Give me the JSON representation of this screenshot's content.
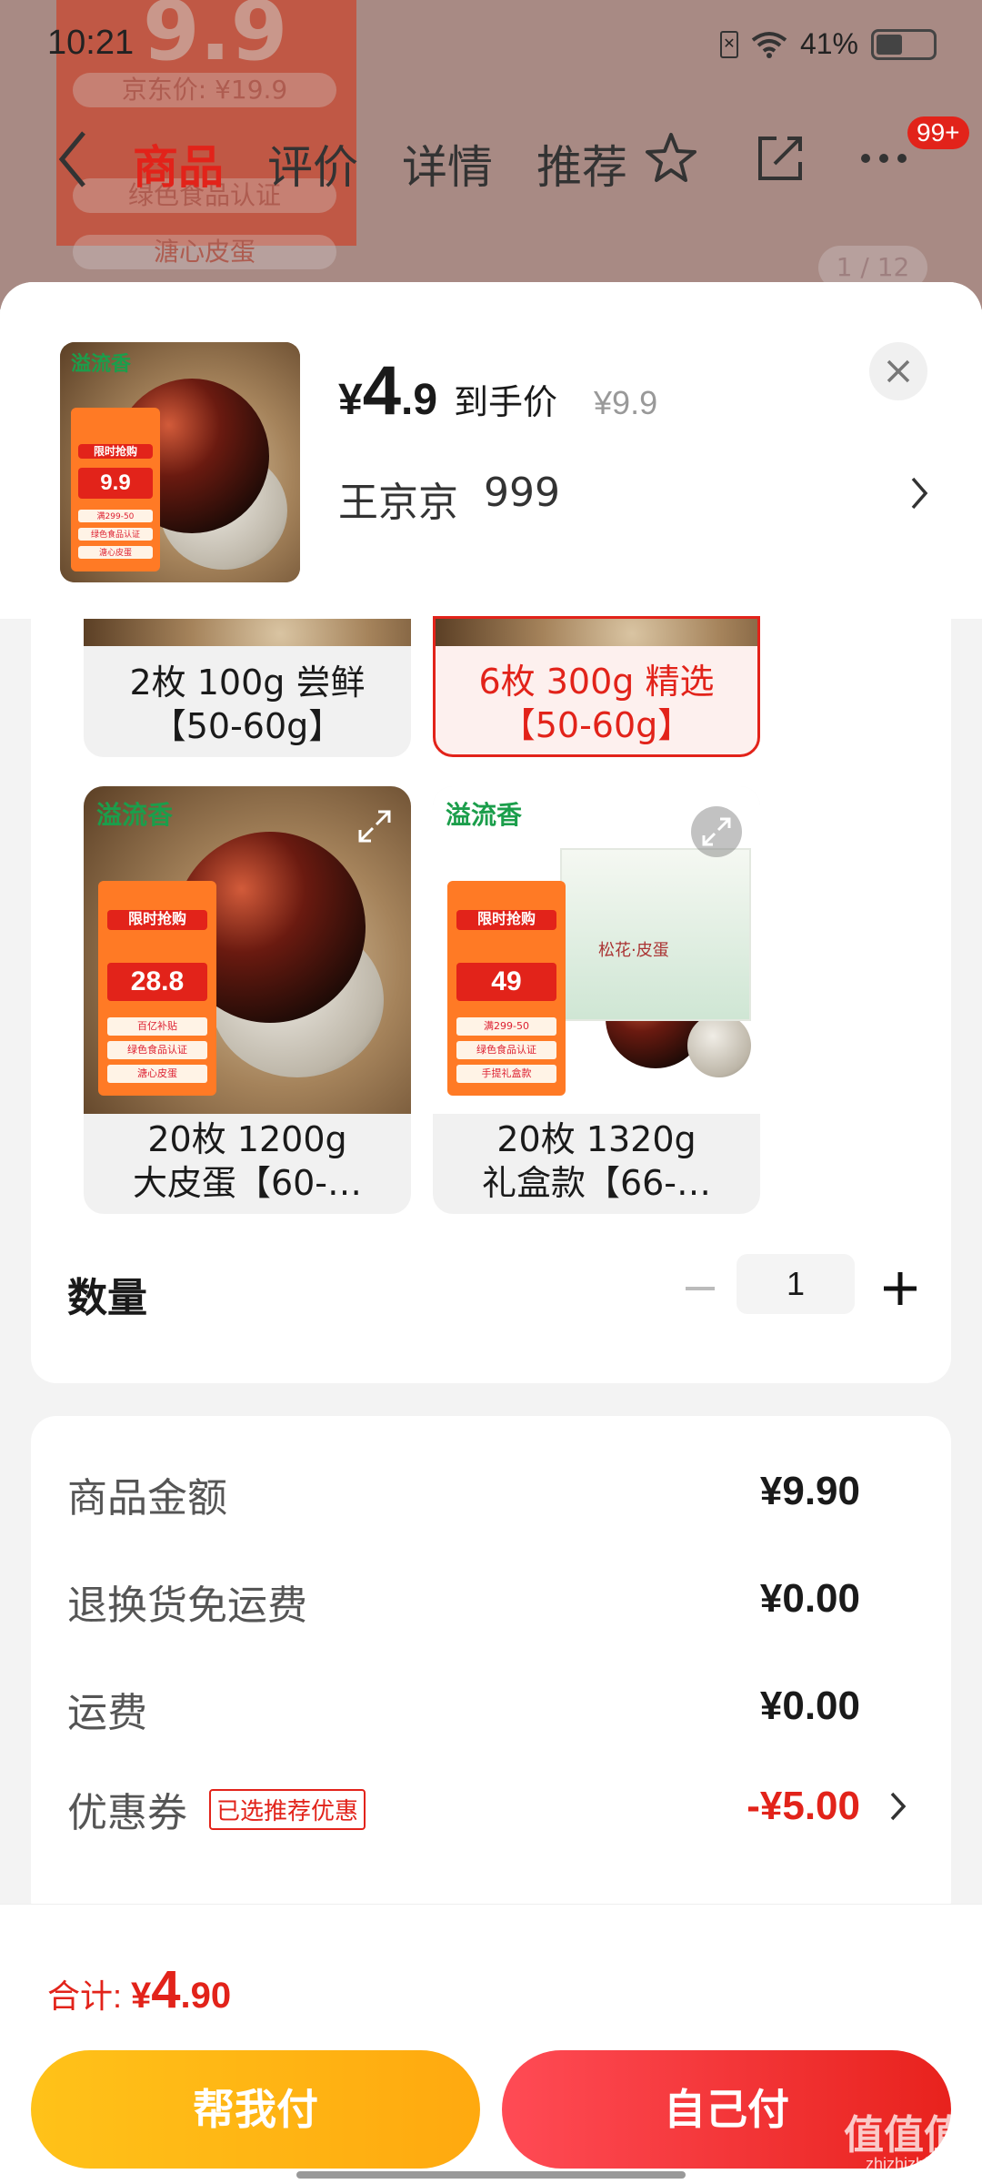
{
  "status_bar": {
    "time": "10:21",
    "battery": "41%"
  },
  "background": {
    "banner_price": "9.9",
    "tags": [
      "京东价: ¥19.9",
      "满299-50",
      "绿色食品认证",
      "溏心皮蛋"
    ],
    "image_counter": "1 / 12"
  },
  "nav": {
    "tabs": [
      "商品",
      "评价",
      "详情",
      "推荐"
    ],
    "active_tab": "商品",
    "badge": "99+"
  },
  "product": {
    "price_currency": "¥",
    "price_int": "4",
    "price_dec": ".9",
    "price_label": "到手价",
    "original_price": "¥9.9",
    "seller": "王京京",
    "quantity_shown": "999",
    "thumb": {
      "logo": "溢流香",
      "promo_title": "限时抢购",
      "promo_price": "9.9",
      "promo_lines": [
        "满299-50",
        "绿色食品认证",
        "溏心皮蛋"
      ]
    }
  },
  "options": [
    {
      "label_line1": "2枚 100g 尝鲜",
      "label_line2": "【50-60g】",
      "selected": false
    },
    {
      "label_line1": "6枚 300g 精选",
      "label_line2": "【50-60g】",
      "selected": true
    },
    {
      "label_line1": "20枚 1200g",
      "label_line2": "大皮蛋【60-…",
      "selected": false,
      "logo": "溢流香",
      "promo_title": "限时抢购",
      "promo_price": "28.8",
      "promo_lines": [
        "百亿补贴",
        "绿色食品认证",
        "溏心皮蛋"
      ]
    },
    {
      "label_line1": "20枚 1320g",
      "label_line2": "礼盒款【66-…",
      "selected": false,
      "logo": "溢流香",
      "promo_title": "限时抢购",
      "promo_price": "49",
      "promo_lines": [
        "满299-50",
        "绿色食品认证",
        "手提礼盒款"
      ],
      "box_text": "松花·皮蛋"
    }
  ],
  "quantity": {
    "label": "数量",
    "value": "1"
  },
  "summary": [
    {
      "key": "商品金额",
      "value": "¥9.90"
    },
    {
      "key": "退换货免运费",
      "value": "¥0.00"
    },
    {
      "key": "运费",
      "value": "¥0.00"
    },
    {
      "key": "优惠券",
      "value": "-¥5.00",
      "tag": "已选推荐优惠"
    }
  ],
  "footer": {
    "total_label": "合计:",
    "total_currency": "¥",
    "total_int": "4",
    "total_dec": ".90",
    "help_pay": "帮我付",
    "self_pay": "自己付"
  },
  "watermark": {
    "text": "值值值",
    "sub": "zhizhizhi.com"
  },
  "colors": {
    "accent_red": "#e2231a",
    "help_yellow": "#ffb413",
    "logo_green": "#1b9e4b"
  }
}
